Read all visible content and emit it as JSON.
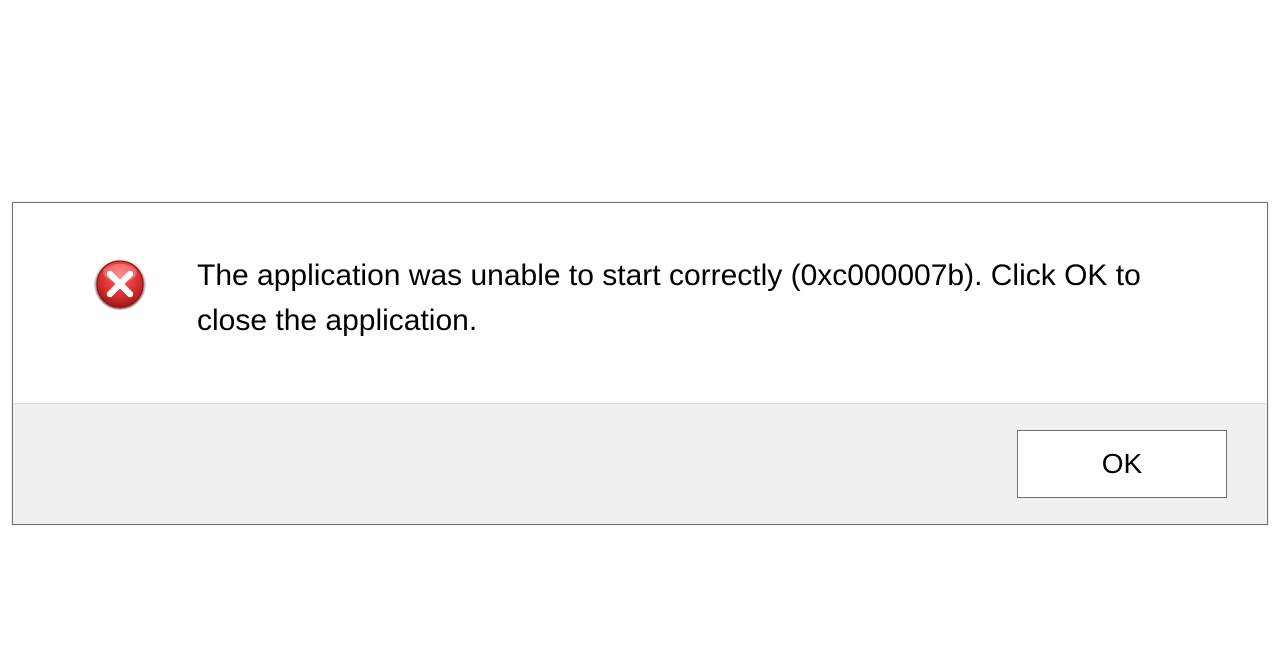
{
  "dialog": {
    "message": "The application was unable to start correctly (0xc000007b). Click OK to close the application.",
    "ok_label": "OK",
    "icon": "error-x-icon"
  }
}
